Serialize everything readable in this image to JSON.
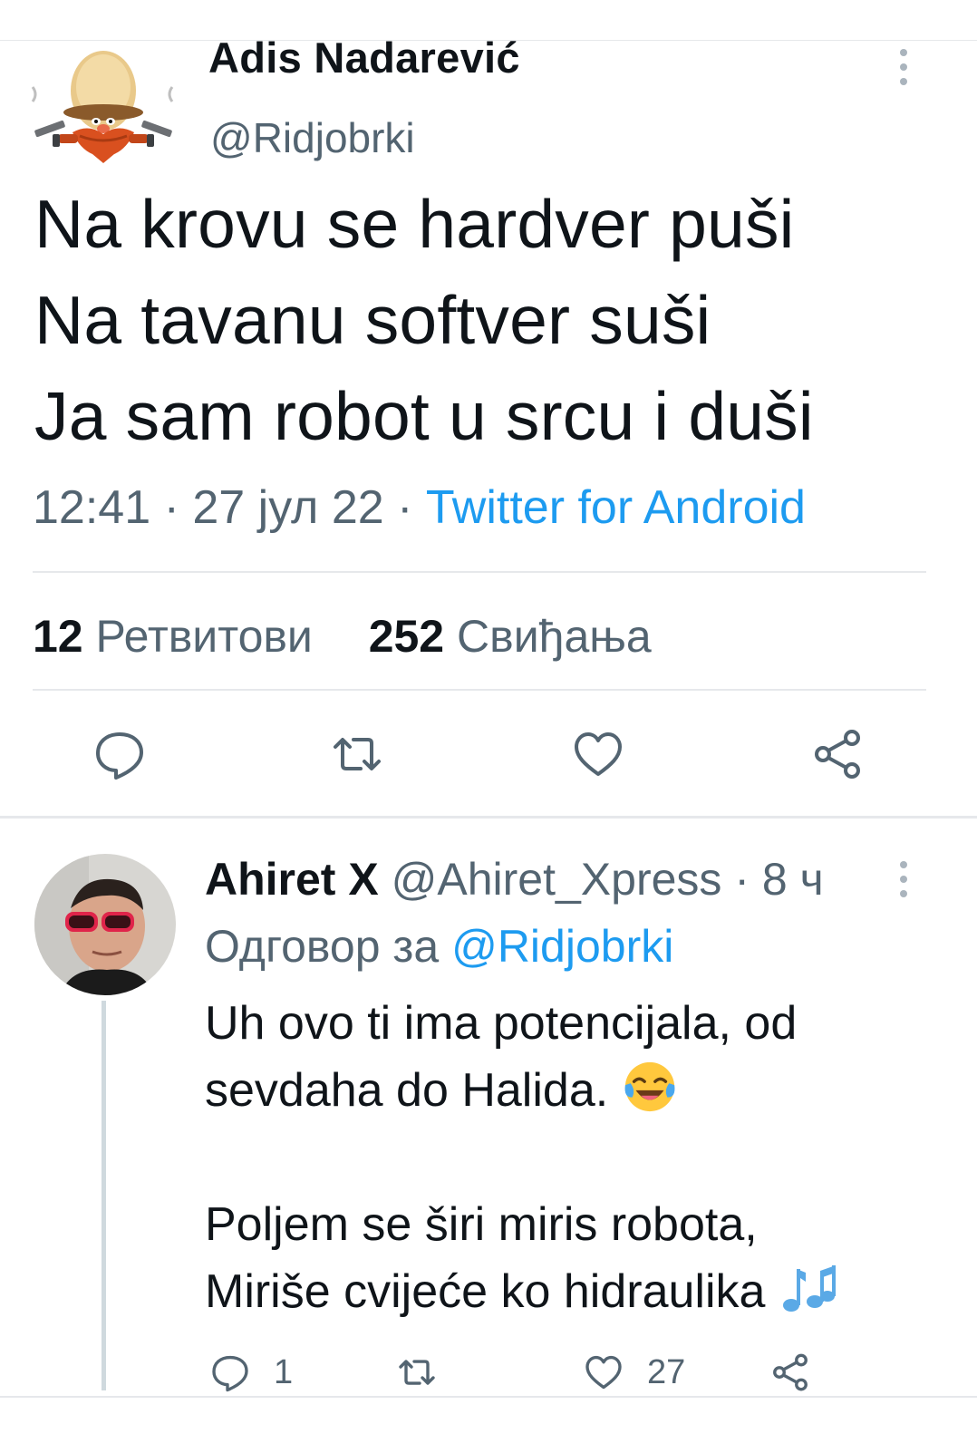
{
  "tweet": {
    "author_name": "Adis Nadarević",
    "author_handle": "@Ridjobrki",
    "text": "Na krovu se hardver puši\nNa tavanu softver suši\nJa sam robot u srcu i duši",
    "time": "12:41",
    "date": "27 јул 22",
    "source": "Twitter for Android",
    "retweets_count": "12",
    "retweets_label": "Ретвитови",
    "likes_count": "252",
    "likes_label": "Свиђања",
    "actions": [
      "reply-icon",
      "retweet-icon",
      "like-icon",
      "share-icon"
    ]
  },
  "reply": {
    "author_name": "Ahiret X",
    "author_handle": "@Ahiret_Xpress",
    "age": "8 ч",
    "replying_label": "Одговор за",
    "replying_to": "@Ridjobrki",
    "text_part1": "Uh ovo ti ima potencijala, od\nsevdaha do Halida.",
    "text_part2": "Poljem se širi miris robota,\nMiriše cvijeće ko hidraulika",
    "emoji_1": "face-with-tears-of-joy",
    "emoji_2": "musical-notes",
    "reply_count": "1",
    "retweet_count": "",
    "like_count": "27"
  },
  "colors": {
    "accent": "#1d9bf0",
    "secondary_text": "#536471",
    "divider": "#e6e8eb"
  }
}
